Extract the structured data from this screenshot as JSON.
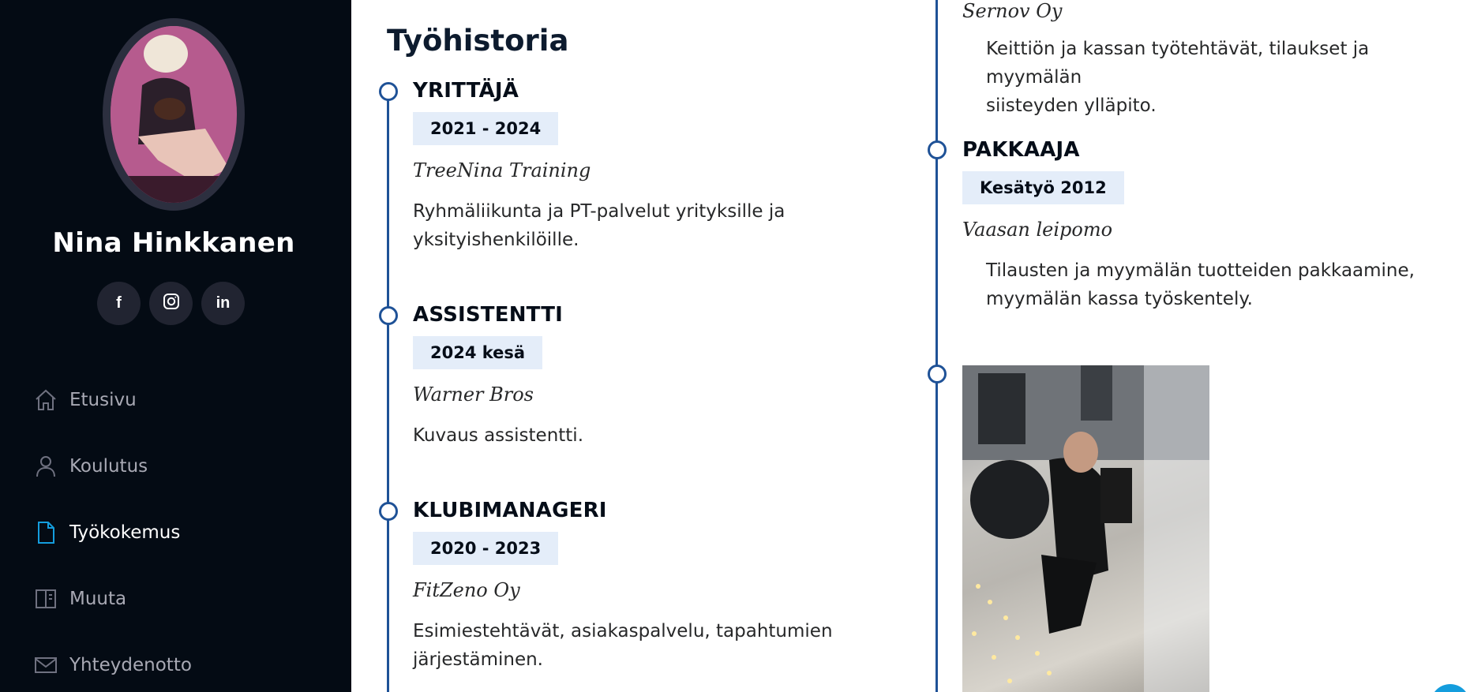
{
  "profile": {
    "name": "Nina Hinkkanen",
    "social": [
      {
        "icon": "facebook-icon",
        "glyph": "f"
      },
      {
        "icon": "instagram-icon",
        "glyph": ""
      },
      {
        "icon": "linkedin-icon",
        "glyph": "in"
      }
    ]
  },
  "nav": {
    "items": [
      {
        "label": "Etusivu",
        "icon": "home-icon"
      },
      {
        "label": "Koulutus",
        "icon": "person-icon"
      },
      {
        "label": "Työkokemus",
        "icon": "file-icon",
        "active": true
      },
      {
        "label": "Muuta",
        "icon": "book-icon"
      },
      {
        "label": "Yhteydenotto",
        "icon": "envelope-icon"
      }
    ]
  },
  "main": {
    "title": "Työhistoria",
    "left_jobs": [
      {
        "title": "YRITTÄJÄ",
        "date": "2021 - 2024",
        "company": "TreeNina Training",
        "desc": [
          "Ryhmäliikunta ja PT-palvelut yrityksille ja",
          "yksityishenkilöille."
        ]
      },
      {
        "title": "ASSISTENTTI",
        "date": "2024 kesä",
        "company": "Warner Bros",
        "desc": [
          "Kuvaus assistentti."
        ]
      },
      {
        "title": "KLUBIMANAGERI",
        "date": "2020 - 2023",
        "company": "FitZeno Oy",
        "desc": [
          "Esimiestehtävät, asiakaspalvelu, tapahtumien",
          "järjestäminen."
        ]
      }
    ],
    "right_top": {
      "company": "Sernov Oy",
      "desc": [
        "Keittiön ja kassan työtehtävät, tilaukset ja myymälän",
        "siisteyden ylläpito."
      ]
    },
    "right_jobs": [
      {
        "title": "PAKKAAJA",
        "date": "Kesätyö 2012",
        "company": "Vaasan leipomo",
        "desc": [
          "Tilausten ja myymälän tuotteiden pakkaamine,",
          "myymälän kassa työskentely."
        ]
      }
    ]
  },
  "colors": {
    "sidebar_bg": "#040b14",
    "accent": "#149ddd",
    "timeline": "#1f5297",
    "date_bg": "#e4edf9"
  }
}
